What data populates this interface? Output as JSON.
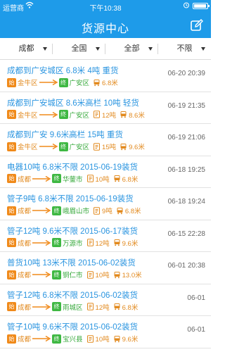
{
  "status_bar": {
    "carrier": "运营商",
    "time": "下午10:38"
  },
  "nav": {
    "title": "货源中心"
  },
  "filters": [
    {
      "label": "成都"
    },
    {
      "label": "全国"
    },
    {
      "label": "全部"
    },
    {
      "label": "不限"
    }
  ],
  "route_labels": {
    "start": "始",
    "end": "终"
  },
  "listings": [
    {
      "title": "成都到广安城区 6.8米 4吨  重货",
      "date": "06-20 20:39",
      "from": "金牛区",
      "to": "广安区",
      "weight": "",
      "length": "6.8米"
    },
    {
      "title": "成都到广安城区 8.6米高栏 10吨  轻货",
      "date": "06-19 21:35",
      "from": "金牛区",
      "to": "广安区",
      "weight": "12吨",
      "length": "8.6米"
    },
    {
      "title": "成都到广安 9.6米高栏 15吨  重货",
      "date": "06-19 21:06",
      "from": "金牛区",
      "to": "广安区",
      "weight": "15吨",
      "length": "9.6米"
    },
    {
      "title": "电器10吨 6.8米不限 2015-06-19装货",
      "date": "06-18 19:25",
      "from": "成都",
      "to": "华蓥市",
      "weight": "10吨",
      "length": "6.8米"
    },
    {
      "title": "管子9吨 6.8米不限 2015-06-19装货",
      "date": "06-18 19:24",
      "from": "成都",
      "to": "峨眉山市",
      "weight": "9吨",
      "length": "6.8米"
    },
    {
      "title": "管子12吨 9.6米不限 2015-06-17装货",
      "date": "06-15 22:28",
      "from": "成都",
      "to": "万源市",
      "weight": "12吨",
      "length": "9.6米"
    },
    {
      "title": "普货10吨 13米不限 2015-06-02装货",
      "date": "06-01 20:38",
      "from": "成都",
      "to": "铜仁市",
      "weight": "10吨",
      "length": "13.0米"
    },
    {
      "title": "管子12吨 6.8米不限 2015-06-02装货",
      "date": "06-01",
      "from": "成都",
      "to": "雨城区",
      "weight": "12吨",
      "length": "6.8米"
    },
    {
      "title": "管子10吨 9.6米不限 2015-06-02装货",
      "date": "06-01",
      "from": "成都",
      "to": "宝兴县",
      "weight": "10吨",
      "length": "9.6米"
    }
  ]
}
